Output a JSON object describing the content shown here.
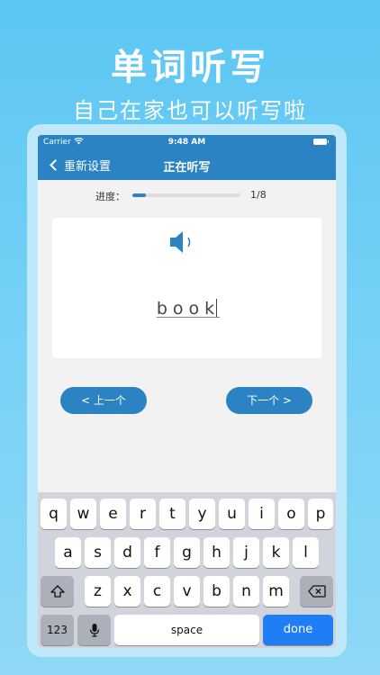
{
  "promo": {
    "title": "单词听写",
    "subtitle": "自己在家也可以听写啦"
  },
  "status_bar": {
    "carrier": "Carrier",
    "time": "9:48 AM"
  },
  "navbar": {
    "back_label": "重新设置",
    "title": "正在听写"
  },
  "progress": {
    "label": "进度：",
    "current": 1,
    "total": 8,
    "count_text": "1/8"
  },
  "word_card": {
    "answer_letters": [
      "b",
      "o",
      "o",
      "k"
    ]
  },
  "buttons": {
    "prev_label": "<  上一个",
    "next_label": "下一个  >"
  },
  "keyboard": {
    "row1": [
      "q",
      "w",
      "e",
      "r",
      "t",
      "y",
      "u",
      "i",
      "o",
      "p"
    ],
    "row2": [
      "a",
      "s",
      "d",
      "f",
      "g",
      "h",
      "j",
      "k",
      "l"
    ],
    "row3": [
      "z",
      "x",
      "c",
      "v",
      "b",
      "n",
      "m"
    ],
    "numbers_label": "123",
    "space_label": "space",
    "done_label": "done"
  },
  "colors": {
    "accent": "#2b83c3",
    "done_key": "#1f7ef6"
  }
}
